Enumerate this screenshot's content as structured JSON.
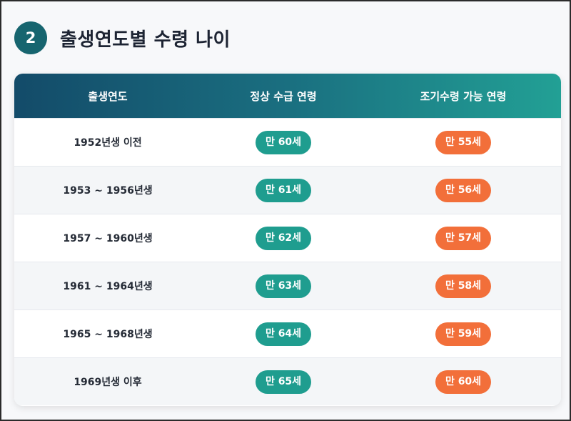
{
  "section": {
    "number": "2",
    "title": "출생연도별 수령 나이"
  },
  "table": {
    "headers": [
      "출생연도",
      "정상 수급 연령",
      "조기수령 가능 연령"
    ],
    "rows": [
      {
        "birth_year": "1952년생 이전",
        "normal_age": "만 60세",
        "early_age": "만 55세"
      },
      {
        "birth_year": "1953 ~ 1956년생",
        "normal_age": "만 61세",
        "early_age": "만 56세"
      },
      {
        "birth_year": "1957 ~ 1960년생",
        "normal_age": "만 62세",
        "early_age": "만 57세"
      },
      {
        "birth_year": "1961 ~ 1964년생",
        "normal_age": "만 63세",
        "early_age": "만 58세"
      },
      {
        "birth_year": "1965 ~ 1968년생",
        "normal_age": "만 64세",
        "early_age": "만 59세"
      },
      {
        "birth_year": "1969년생 이후",
        "normal_age": "만 65세",
        "early_age": "만 60세"
      }
    ]
  },
  "colors": {
    "badge": "#17656f",
    "header_gradient_start": "#134b69",
    "header_gradient_end": "#22a095",
    "normal_pill": "#1f9d8f",
    "early_pill": "#f26f3a"
  }
}
